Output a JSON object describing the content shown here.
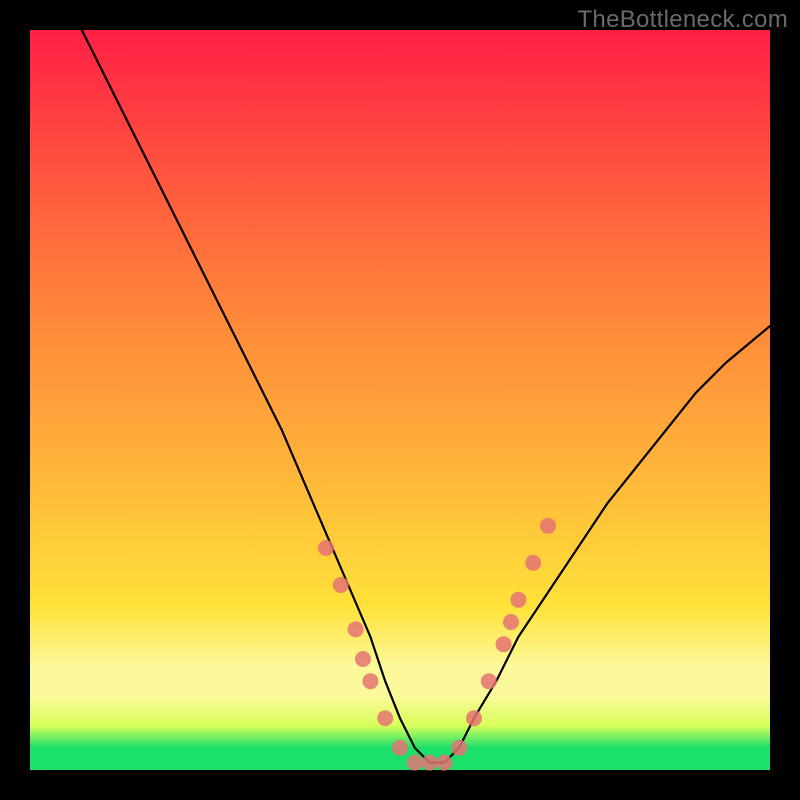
{
  "watermark": "TheBottleneck.com",
  "colors": {
    "top": "#ff1f44",
    "mid1": "#ff7f3a",
    "mid2": "#ffb13a",
    "mid3": "#ffe23a",
    "band": "#fbf99a",
    "low": "#d8ff5a",
    "green": "#1be06a",
    "curve": "#000000",
    "marker_fill": "#e57373",
    "marker_stroke": "#c94f4f"
  },
  "chart_data": {
    "type": "line",
    "title": "",
    "xlabel": "",
    "ylabel": "",
    "xlim": [
      0,
      100
    ],
    "ylim": [
      0,
      100
    ],
    "series": [
      {
        "name": "bottleneck-curve",
        "x": [
          7,
          10,
          14,
          18,
          22,
          26,
          30,
          34,
          37,
          40,
          43,
          46,
          48,
          50,
          52,
          54,
          56,
          58,
          60,
          63,
          66,
          70,
          74,
          78,
          82,
          86,
          90,
          94,
          100
        ],
        "y": [
          100,
          94,
          86,
          78,
          70,
          62,
          54,
          46,
          39,
          32,
          25,
          18,
          12,
          7,
          3,
          1,
          1,
          3,
          7,
          12,
          18,
          24,
          30,
          36,
          41,
          46,
          51,
          55,
          60
        ]
      }
    ],
    "markers": [
      {
        "x": 40,
        "y": 30
      },
      {
        "x": 42,
        "y": 25
      },
      {
        "x": 44,
        "y": 19
      },
      {
        "x": 45,
        "y": 15
      },
      {
        "x": 46,
        "y": 12
      },
      {
        "x": 48,
        "y": 7
      },
      {
        "x": 50,
        "y": 3
      },
      {
        "x": 52,
        "y": 1
      },
      {
        "x": 54,
        "y": 1
      },
      {
        "x": 56,
        "y": 1
      },
      {
        "x": 58,
        "y": 3
      },
      {
        "x": 60,
        "y": 7
      },
      {
        "x": 62,
        "y": 12
      },
      {
        "x": 64,
        "y": 17
      },
      {
        "x": 65,
        "y": 20
      },
      {
        "x": 66,
        "y": 23
      },
      {
        "x": 68,
        "y": 28
      },
      {
        "x": 70,
        "y": 33
      }
    ]
  }
}
